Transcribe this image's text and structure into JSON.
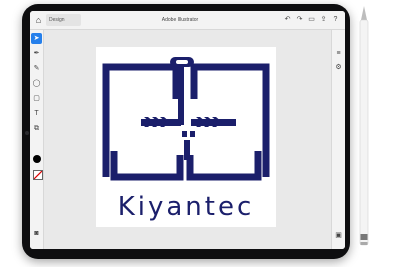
{
  "app": {
    "title": "Adobe Illustrator"
  },
  "tabs": [
    {
      "label": "Design"
    }
  ],
  "artwork": {
    "wordmark": "Kiyantec",
    "brand_color": "#1b1f6b"
  },
  "icons": {
    "home": "home-icon",
    "undo": "undo-icon",
    "redo": "redo-icon",
    "layers": "layers-icon",
    "share": "share-icon",
    "help": "help-icon"
  }
}
